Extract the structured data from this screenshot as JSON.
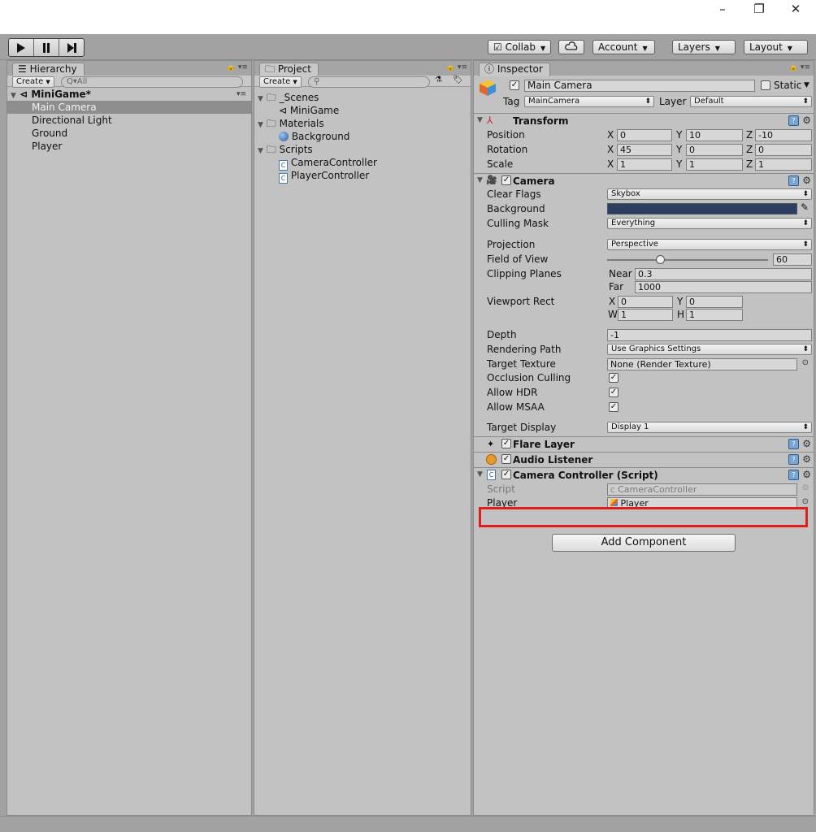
{
  "window": {
    "minimize": "–",
    "maximize": "❐",
    "close": "✕"
  },
  "toolbar": {
    "play_icon": "play-icon",
    "pause_icon": "pause-icon",
    "step_icon": "step-icon",
    "collab": "Collab",
    "account": "Account",
    "layers": "Layers",
    "layout": "Layout"
  },
  "hierarchy": {
    "tab": "Hierarchy",
    "create": "Create",
    "search_placeholder": "Q▾All",
    "scene": "MiniGame*",
    "items": [
      "Main Camera",
      "Directional Light",
      "Ground",
      "Player"
    ],
    "selected": "Main Camera"
  },
  "project": {
    "tab": "Project",
    "create": "Create",
    "tree": [
      {
        "label": "_Scenes",
        "kind": "folder",
        "children": [
          {
            "label": "MiniGame",
            "kind": "scene"
          }
        ]
      },
      {
        "label": "Materials",
        "kind": "folder",
        "children": [
          {
            "label": "Background",
            "kind": "material"
          }
        ]
      },
      {
        "label": "Scripts",
        "kind": "folder",
        "children": [
          {
            "label": "CameraController",
            "kind": "script"
          },
          {
            "label": "PlayerController",
            "kind": "script"
          }
        ]
      }
    ]
  },
  "inspector": {
    "tab": "Inspector",
    "object_name": "Main Camera",
    "static_label": "Static",
    "tag_label": "Tag",
    "tag_value": "MainCamera",
    "layer_label": "Layer",
    "layer_value": "Default",
    "transform": {
      "title": "Transform",
      "position": {
        "label": "Position",
        "x": "0",
        "y": "10",
        "z": "-10"
      },
      "rotation": {
        "label": "Rotation",
        "x": "45",
        "y": "0",
        "z": "0"
      },
      "scale": {
        "label": "Scale",
        "x": "1",
        "y": "1",
        "z": "1"
      }
    },
    "camera": {
      "title": "Camera",
      "clear_flags": {
        "label": "Clear Flags",
        "value": "Skybox"
      },
      "background": {
        "label": "Background",
        "color": "#2c3f63"
      },
      "culling_mask": {
        "label": "Culling Mask",
        "value": "Everything"
      },
      "projection": {
        "label": "Projection",
        "value": "Perspective"
      },
      "fov": {
        "label": "Field of View",
        "value": "60",
        "slider_fraction": 0.33
      },
      "clipping": {
        "label": "Clipping Planes",
        "near_label": "Near",
        "near": "0.3",
        "far_label": "Far",
        "far": "1000"
      },
      "viewport": {
        "label": "Viewport Rect",
        "x": "0",
        "y": "0",
        "w": "1",
        "h": "1"
      },
      "depth": {
        "label": "Depth",
        "value": "-1"
      },
      "rendering_path": {
        "label": "Rendering Path",
        "value": "Use Graphics Settings"
      },
      "target_texture": {
        "label": "Target Texture",
        "value": "None (Render Texture)"
      },
      "occlusion_culling": {
        "label": "Occlusion Culling"
      },
      "allow_hdr": {
        "label": "Allow HDR"
      },
      "allow_msaa": {
        "label": "Allow MSAA"
      },
      "target_display": {
        "label": "Target Display",
        "value": "Display 1"
      }
    },
    "flare_layer": {
      "title": "Flare Layer"
    },
    "audio_listener": {
      "title": "Audio Listener"
    },
    "camera_controller": {
      "title": "Camera Controller (Script)",
      "script_label": "Script",
      "script_value": "CameraController",
      "player_label": "Player",
      "player_value": "Player"
    },
    "add_component": "Add Component"
  },
  "colors": {
    "highlight": "#e21b1b",
    "selection": "#8e8e8e",
    "panel": "#c2c2c2"
  }
}
